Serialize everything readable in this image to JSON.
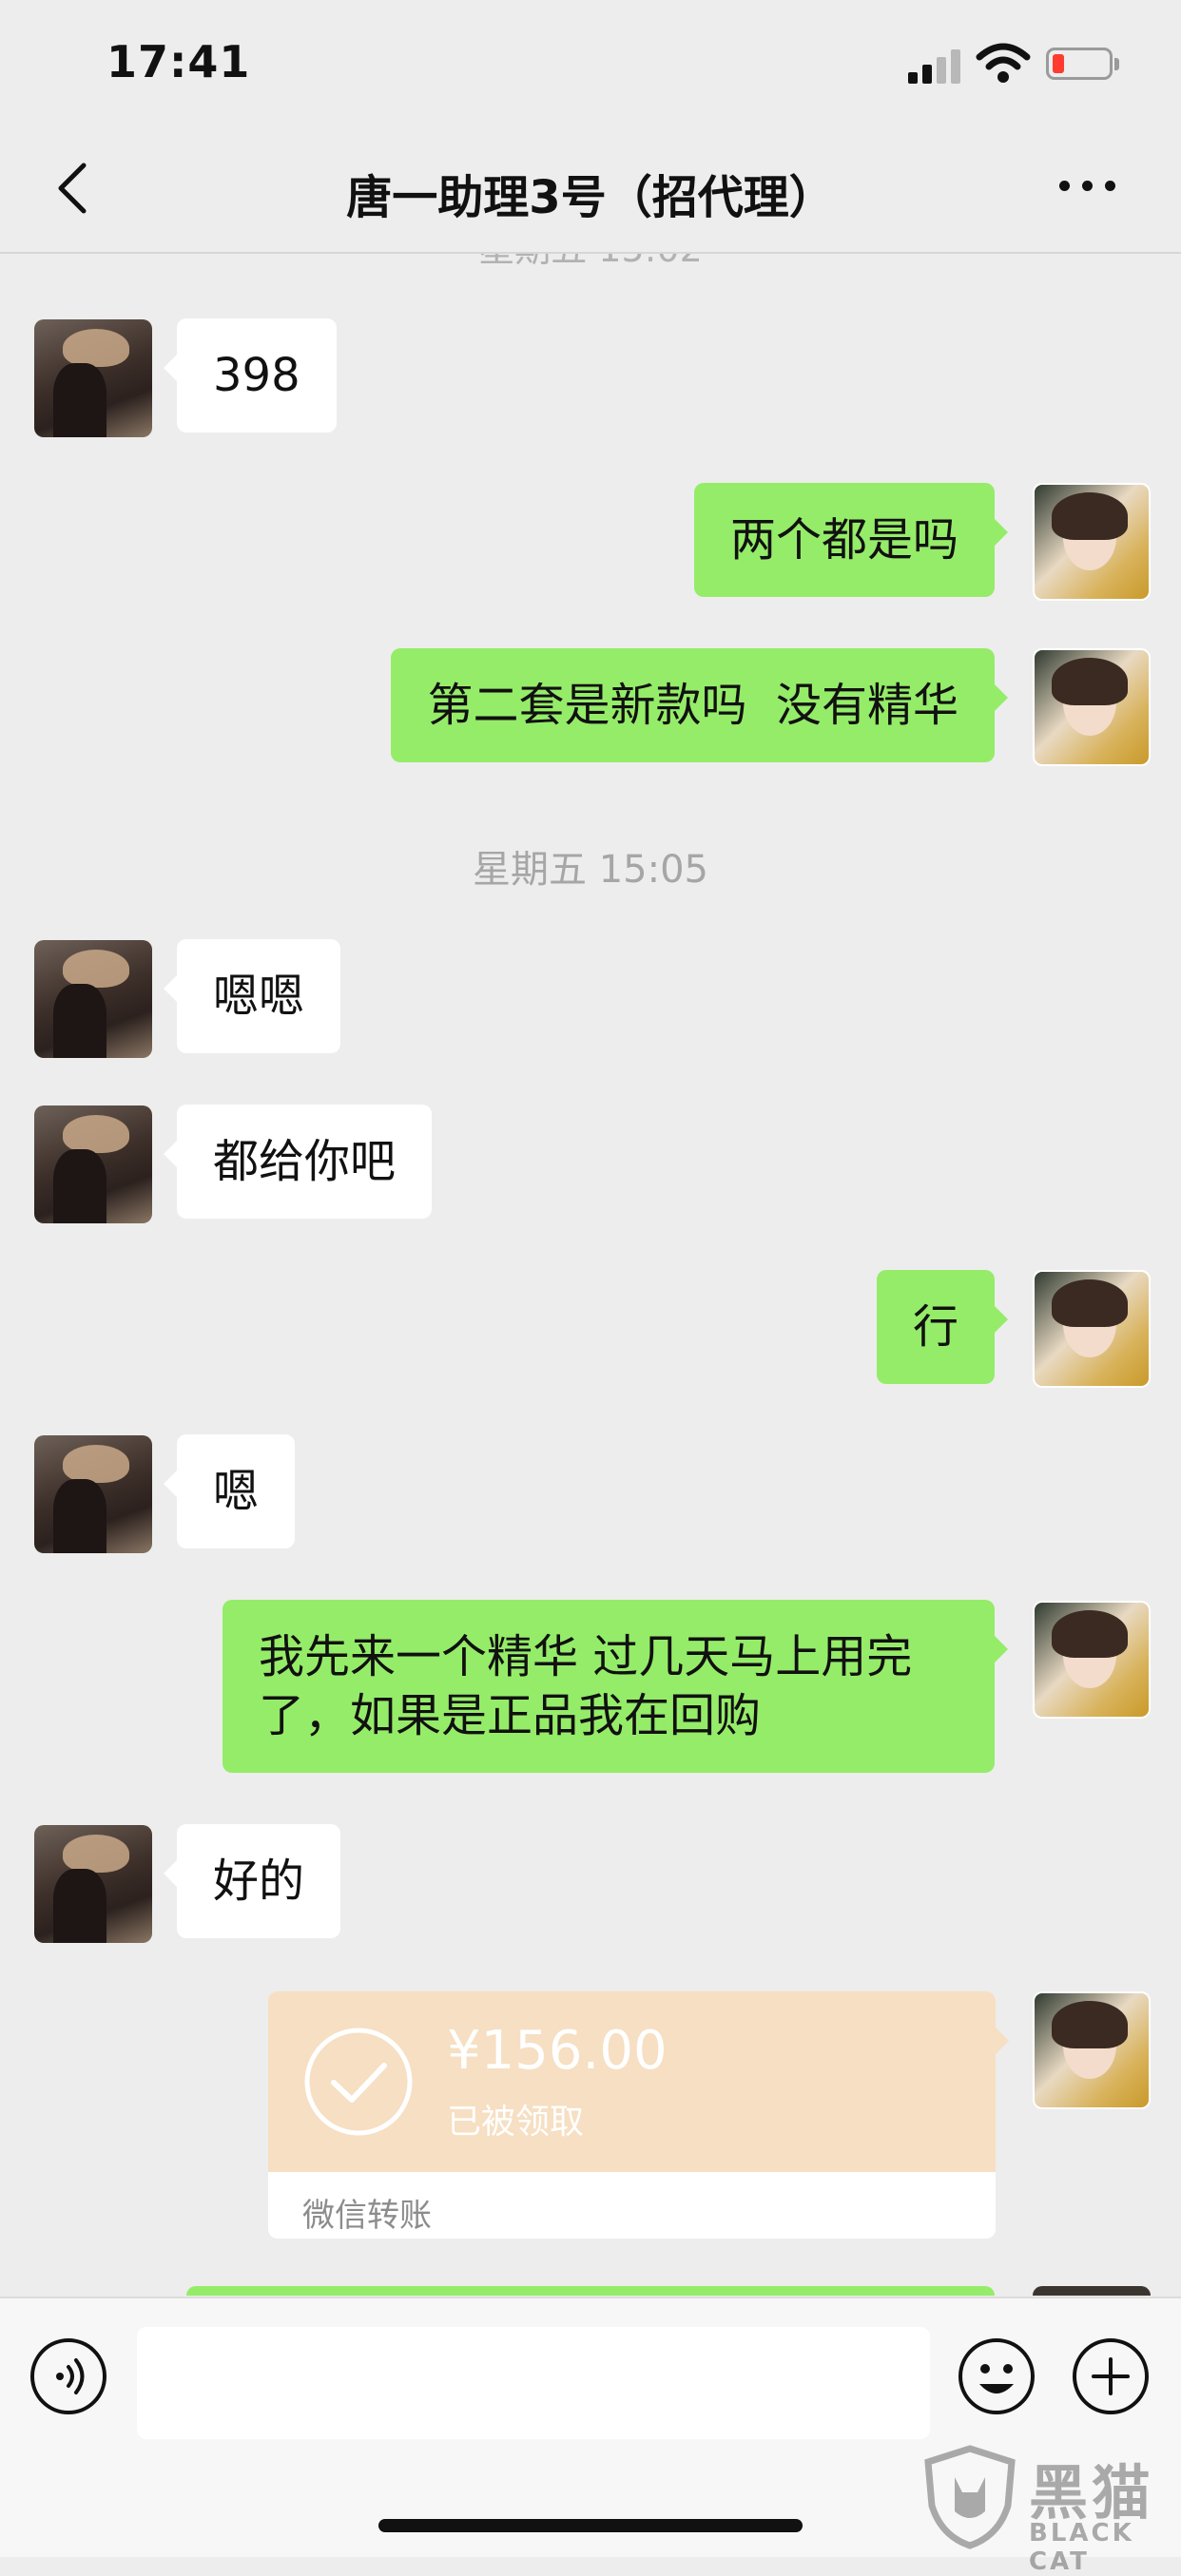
{
  "status_bar": {
    "time": "17:41"
  },
  "header": {
    "title": "唐一助理3号（招代理）"
  },
  "chat": {
    "clipped_timestamp": "星期五 15:02",
    "timestamp": "星期五 15:05",
    "messages": [
      {
        "from": "them",
        "text": "398"
      },
      {
        "from": "me",
        "text": "两个都是吗"
      },
      {
        "from": "me",
        "text": "第二套是新款吗  没有精华"
      },
      {
        "from": "them",
        "text": "嗯嗯"
      },
      {
        "from": "them",
        "text": "都给你吧"
      },
      {
        "from": "me",
        "text": "行"
      },
      {
        "from": "them",
        "text": "嗯"
      },
      {
        "from": "me",
        "text": "我先来一个精华 过几天马上用完\n了，如果是正品我在回购"
      },
      {
        "from": "them",
        "text": "好的"
      }
    ],
    "transfer": {
      "amount": "¥156.00",
      "status": "已被领取",
      "label": "微信转账"
    }
  },
  "input": {
    "placeholder": ""
  },
  "watermark": {
    "cn": "黑猫",
    "en": "BLACK CAT"
  },
  "colors": {
    "background": "#ededed",
    "outgoing_bubble": "#95ec69",
    "incoming_bubble": "#ffffff",
    "transfer_card": "#f6dfc2"
  }
}
